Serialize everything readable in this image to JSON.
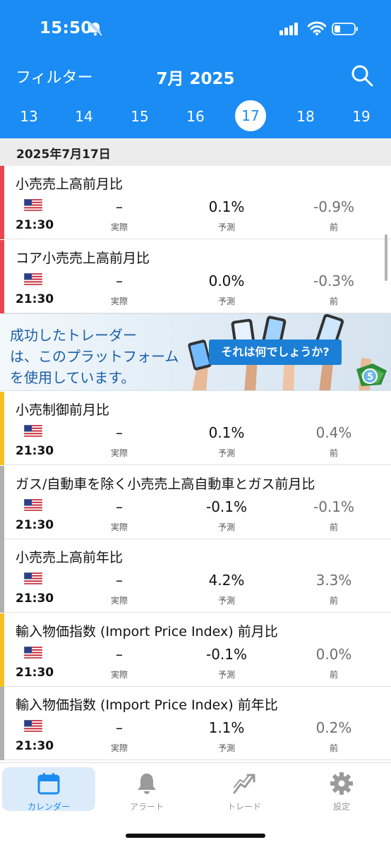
{
  "status": {
    "time": "15:50"
  },
  "nav": {
    "filter": "フィルター",
    "month": "7月 2025"
  },
  "days": [
    "13",
    "14",
    "15",
    "16",
    "17",
    "18",
    "19"
  ],
  "selected_day": "17",
  "date_header": "2025年7月17日",
  "labels": {
    "actual": "実際",
    "forecast": "予測",
    "previous": "前"
  },
  "colors": {
    "header": "#1a8cf4",
    "high": "#e8474f",
    "medium": "#f5bf1f",
    "low": "#b0b0b0"
  },
  "events_top": [
    {
      "title": "小売売上高前月比",
      "time": "21:30",
      "actual": "–",
      "forecast": "0.1%",
      "previous": "-0.9%",
      "importance": "high"
    },
    {
      "title": "コア小売売上高前月比",
      "time": "21:30",
      "actual": "–",
      "forecast": "0.0%",
      "previous": "-0.3%",
      "importance": "high"
    }
  ],
  "ad": {
    "line1": "成功したトレーダー",
    "line2": "は、このプラットフォーム",
    "line3": "を使用しています。",
    "cta": "それは何でしょうか?"
  },
  "events_bottom": [
    {
      "title": "小売制御前月比",
      "time": "21:30",
      "actual": "–",
      "forecast": "0.1%",
      "previous": "0.4%",
      "importance": "medium"
    },
    {
      "title": "ガス/自動車を除く小売売上高自動車とガス前月比",
      "time": "21:30",
      "actual": "–",
      "forecast": "-0.1%",
      "previous": "-0.1%",
      "importance": "low"
    },
    {
      "title": "小売売上高前年比",
      "time": "21:30",
      "actual": "–",
      "forecast": "4.2%",
      "previous": "3.3%",
      "importance": "low"
    },
    {
      "title": "輸入物価指数 (Import Price Index) 前月比",
      "time": "21:30",
      "actual": "–",
      "forecast": "-0.1%",
      "previous": "0.0%",
      "importance": "medium"
    },
    {
      "title": "輸入物価指数 (Import Price Index) 前年比",
      "time": "21:30",
      "actual": "–",
      "forecast": "1.1%",
      "previous": "0.2%",
      "importance": "low"
    }
  ],
  "tabs": [
    {
      "label": "カレンダー",
      "icon": "calendar-icon",
      "active": true
    },
    {
      "label": "アラート",
      "icon": "bell-icon",
      "active": false
    },
    {
      "label": "トレード",
      "icon": "trade-icon",
      "active": false
    },
    {
      "label": "設定",
      "icon": "gear-icon",
      "active": false
    }
  ]
}
